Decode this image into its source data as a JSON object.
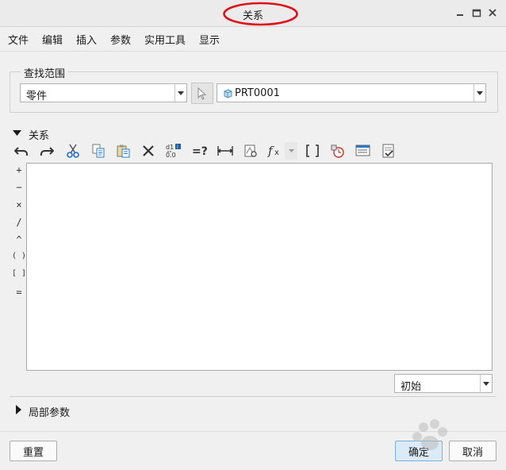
{
  "window": {
    "title": "关系"
  },
  "menu": [
    "文件",
    "编辑",
    "插入",
    "参数",
    "实用工具",
    "显示"
  ],
  "scope": {
    "legend": "查找范围",
    "type_value": "零件",
    "object_value": "PRT0001"
  },
  "relations": {
    "header": "关系",
    "operators": [
      "+",
      "−",
      "×",
      "/",
      "^",
      "( )",
      "[ ]",
      "="
    ],
    "unit_value": "初始"
  },
  "local_params": {
    "header": "局部参数"
  },
  "buttons": {
    "reset": "重置",
    "ok": "确定",
    "cancel": "取消"
  },
  "colors": {
    "accent_circle": "#e0101a",
    "primary_button": "#dbeaf7"
  },
  "icons": [
    "undo-icon",
    "redo-icon",
    "cut-icon",
    "copy-icon",
    "paste-icon",
    "delete-icon",
    "switch-dims-icon",
    "evaluate-icon",
    "measure-icon",
    "param-icon",
    "function-icon",
    "brackets-icon",
    "units-icon",
    "sort-icon",
    "verify-icon"
  ]
}
